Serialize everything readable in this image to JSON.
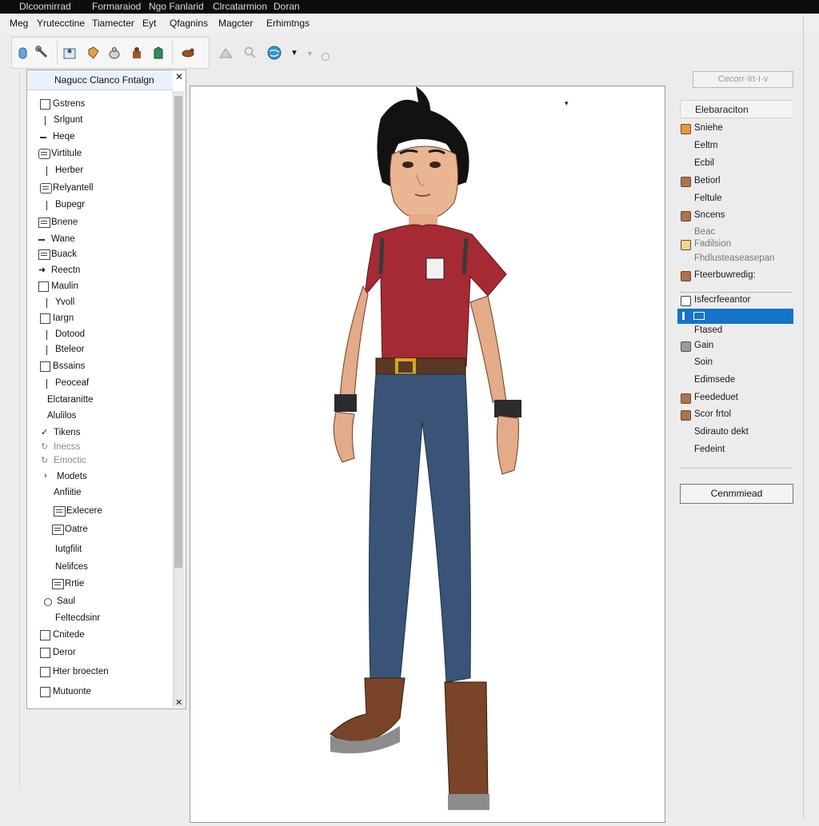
{
  "titlebar": {
    "items": [
      "Dlcoomirrad",
      "Formaraiod",
      "Ngo Fanlarid",
      "Clrcatarmion",
      "Doran"
    ]
  },
  "menubar": {
    "items": [
      "Meg",
      "Yrutecctine",
      "Tiamecter",
      "Eyt",
      "Qfagnins",
      "Magcter",
      "Erhimtngs"
    ]
  },
  "toolbar": {
    "icons": [
      "cursor-icon",
      "wrench-icon",
      "figure-icon",
      "tag-icon",
      "sack-icon",
      "person-icon",
      "shirt-icon",
      "horse-icon",
      "mountain-icon",
      "magnifier-icon",
      "globe-icon",
      "dropdown-arrow-icon",
      "triangle-icon",
      "circle-icon"
    ]
  },
  "left_panel": {
    "title": "Nagucc Clanco Fntalgn",
    "items": [
      {
        "icon": "checkbox",
        "label": "Gstrens"
      },
      {
        "icon": "vbar",
        "label": "Srlgunt"
      },
      {
        "icon": "dash",
        "label": "Heqe"
      },
      {
        "icon": "gear",
        "label": "Virtitule"
      },
      {
        "icon": "vbar",
        "label": "Herber"
      },
      {
        "icon": "gear",
        "label": "Relyantell"
      },
      {
        "icon": "vbar",
        "label": "Bupegr"
      },
      {
        "icon": "doc",
        "label": "Bnene"
      },
      {
        "icon": "dash",
        "label": "Wane"
      },
      {
        "icon": "doc",
        "label": "Buack"
      },
      {
        "icon": "arrow",
        "label": "Reectn"
      },
      {
        "icon": "checkbox",
        "label": "Maulin"
      },
      {
        "icon": "vbar",
        "label": "Yvoll"
      },
      {
        "icon": "checkbox",
        "label": "Iargn"
      },
      {
        "icon": "vbar",
        "label": "Dotood"
      },
      {
        "icon": "vbar",
        "label": "Bteleor"
      },
      {
        "icon": "checkbox",
        "label": "Bssains"
      },
      {
        "icon": "vbar",
        "label": "Peoceaf"
      },
      {
        "icon": "none",
        "label": "Elctaranitte"
      },
      {
        "icon": "none",
        "label": "Alulilos"
      },
      {
        "icon": "check",
        "label": "Tikens"
      },
      {
        "icon": "refresh",
        "label": "Inecss"
      },
      {
        "icon": "refresh",
        "label": "Emoctic"
      },
      {
        "icon": "chevron",
        "label": "Modets"
      },
      {
        "icon": "none",
        "label": "Anfiitie"
      },
      {
        "icon": "doc",
        "label": "Exlecere"
      },
      {
        "icon": "doc",
        "label": "Oatre"
      },
      {
        "icon": "none",
        "label": "Iutgfilit"
      },
      {
        "icon": "none",
        "label": "Nelifces"
      },
      {
        "icon": "doc",
        "label": "Rrtie"
      },
      {
        "icon": "circle",
        "label": "Saul"
      },
      {
        "icon": "none",
        "label": "Feltecdsinr"
      },
      {
        "icon": "checkbox",
        "label": "Cnitede"
      },
      {
        "icon": "checkbox",
        "label": "Deror"
      },
      {
        "icon": "checkbox",
        "label": "Hter broecten"
      },
      {
        "icon": "checkbox",
        "label": "Mutuonte"
      }
    ]
  },
  "canvas": {
    "subject": "character-model"
  },
  "right_panel": {
    "search_placeholder": "Cecorr·Irt·I·v",
    "header": "Elebaraciton",
    "props": [
      {
        "swatch": "#e39a3f",
        "label": "Sniehe"
      },
      {
        "swatch": "",
        "label": "Eeltm"
      },
      {
        "swatch": "",
        "label": "Ecbil"
      },
      {
        "swatch": "#a9744e",
        "label": "Betiorl"
      },
      {
        "swatch": "",
        "label": "Feltule"
      },
      {
        "swatch": "#a9744e",
        "label": "Sncens"
      },
      {
        "swatch": "",
        "label": "Beac",
        "faint": true
      },
      {
        "swatch": "#f4d48c",
        "label": "Fadilsion",
        "faint": true
      },
      {
        "swatch": "",
        "label": "Fhdlusteaseasepan",
        "faint": true
      },
      {
        "swatch": "#a9744e",
        "label": "Fteerbuwredig:"
      }
    ],
    "selected_header": "Isfecrfeeantor",
    "props2": [
      {
        "swatch": "",
        "label": "Ftased"
      },
      {
        "swatch": "#9a9a9a",
        "label": "Gain"
      },
      {
        "swatch": "",
        "label": "Soin"
      },
      {
        "swatch": "",
        "label": "Edimsede"
      },
      {
        "swatch": "#a9744e",
        "label": "Feededuet"
      },
      {
        "swatch": "#a9744e",
        "label": "Scor frtol"
      },
      {
        "swatch": "",
        "label": "Sdirauto dekt"
      },
      {
        "swatch": "",
        "label": "Fedeint"
      }
    ],
    "commit_label": "Cenmmiead"
  }
}
